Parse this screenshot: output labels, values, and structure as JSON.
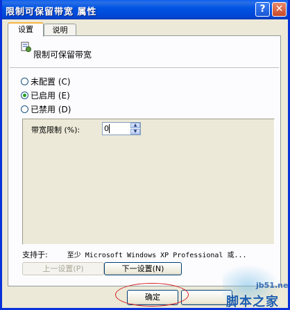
{
  "window": {
    "title": "限制可保留带宽 属性",
    "help_glyph": "?",
    "close_glyph": "✕"
  },
  "tabs": [
    {
      "label": "设置",
      "active": true
    },
    {
      "label": "说明",
      "active": false
    }
  ],
  "policy": {
    "name": "限制可保留带宽",
    "icon": "policy-setting-icon"
  },
  "options": [
    {
      "label": "未配置 (C)",
      "checked": false
    },
    {
      "label": "已启用 (E)",
      "checked": true
    },
    {
      "label": "已禁用 (D)",
      "checked": false
    }
  ],
  "bandwidth": {
    "label": "带宽限制 (%):",
    "value": "0"
  },
  "supported": {
    "label": "支持于:",
    "value": "至少 Microsoft Windows XP Professional 或..."
  },
  "buttons": {
    "prev": "上一设置(P)",
    "next": "下一设置(N)",
    "ok": "确定"
  },
  "watermark": {
    "site": "jb51.net",
    "name": "脚本之家"
  }
}
